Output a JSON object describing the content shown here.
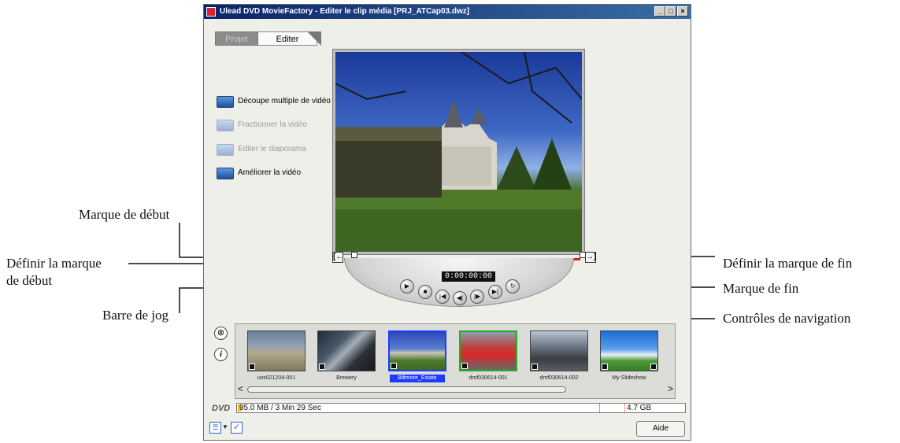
{
  "window": {
    "title": "Ulead DVD MovieFactory - Editer le clip média   [PRJ_ATCap03.dwz]",
    "min_glyph": "_",
    "max_glyph": "□",
    "close_glyph": "×"
  },
  "tabs": [
    {
      "label": "Projet",
      "active": false
    },
    {
      "label": "Editer",
      "active": true
    }
  ],
  "tasks": [
    {
      "label": "Découpe multiple de vidéo",
      "enabled": true
    },
    {
      "label": "Fractionner la vidéo",
      "enabled": false
    },
    {
      "label": "Editer le diaporama",
      "enabled": false
    },
    {
      "label": "Améliorer la vidéo",
      "enabled": true
    }
  ],
  "player": {
    "timecode": "0:00:00:00",
    "mark_in_glyph": "[←",
    "mark_out_glyph": "→]"
  },
  "clips": [
    {
      "caption": "uvs021204-001",
      "selection": "none"
    },
    {
      "caption": "Brewery",
      "selection": "none"
    },
    {
      "caption": "Biltmore_Estate",
      "selection": "blue"
    },
    {
      "caption": "dmf030614-001",
      "selection": "green"
    },
    {
      "caption": "dmf030614-002",
      "selection": "none"
    },
    {
      "caption": "My Slideshow",
      "selection": "none"
    }
  ],
  "strip_icons": {
    "delete": "⊗",
    "info": "i"
  },
  "scroll": {
    "left": "<",
    "right": ">"
  },
  "dvd": {
    "label": "DVD",
    "used": "95.0 MB / 3 Min 29 Sec",
    "total": "4.7 GB"
  },
  "bottom": {
    "help_label": "Aide"
  },
  "callouts": {
    "marque_debut": "Marque de début",
    "definir_debut_1": "Définir la marque",
    "definir_debut_2": "de début",
    "barre_jog": "Barre de jog",
    "definir_fin": "Définir la marque de fin",
    "marque_fin": "Marque de fin",
    "controles": "Contrôles de navigation"
  },
  "colors": {
    "titlebar": "#0a246a",
    "jog_track": "#cc2020",
    "selection_blue": "#1c3dff",
    "selection_green": "#22b022"
  }
}
